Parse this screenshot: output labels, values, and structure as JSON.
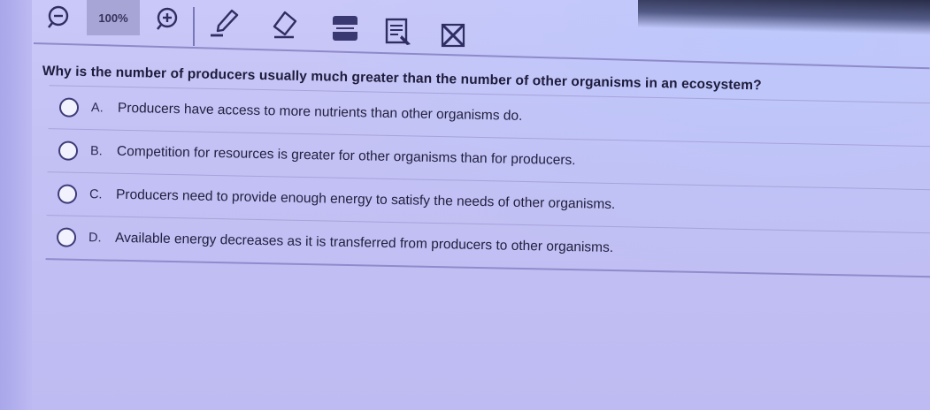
{
  "toolbar": {
    "zoom_out_icon": "zoom-out-icon",
    "zoom_level": "100%",
    "zoom_in_icon": "zoom-in-icon",
    "tools": [
      {
        "name": "pen-icon"
      },
      {
        "name": "eraser-icon"
      },
      {
        "name": "line-reader-icon"
      },
      {
        "name": "notepad-icon"
      },
      {
        "name": "answer-eliminator-icon"
      }
    ]
  },
  "question": {
    "text": "Why is the number of producers usually much greater than the number of other organisms in an ecosystem?",
    "choices": [
      {
        "letter": "A.",
        "text": "Producers have access to more nutrients than other organisms do."
      },
      {
        "letter": "B.",
        "text": "Competition for resources is greater for other organisms than for producers."
      },
      {
        "letter": "C.",
        "text": "Producers need to provide enough energy to satisfy the needs of other organisms."
      },
      {
        "letter": "D.",
        "text": "Available energy decreases as it is transferred from producers to other organisms."
      }
    ]
  },
  "colors": {
    "background": "#c8c6f6",
    "text": "#1e1c3c",
    "icon": "#2f2d62"
  }
}
